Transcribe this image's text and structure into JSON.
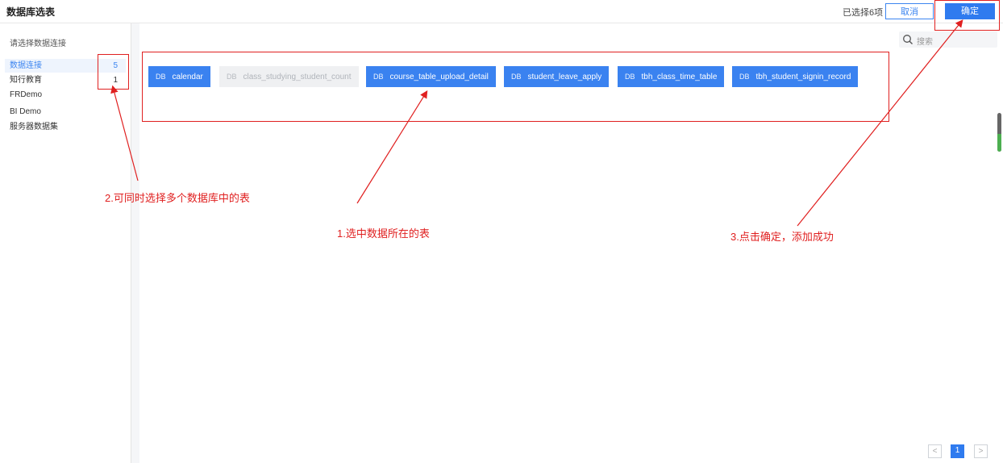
{
  "header": {
    "title": "数据库选表",
    "selected_text": "已选择6项",
    "cancel_label": "取消",
    "ok_label": "确定"
  },
  "sidebar": {
    "header": "请选择数据连接",
    "items": [
      {
        "label": "数据连接",
        "count": "5",
        "active": true
      },
      {
        "label": "知行教育",
        "count": "1",
        "active": false
      },
      {
        "label": "FRDemo",
        "count": "",
        "active": false
      },
      {
        "label": "BI Demo",
        "count": "",
        "active": false
      },
      {
        "label": "服务器数据集",
        "count": "",
        "active": false
      }
    ]
  },
  "search": {
    "placeholder": "搜索"
  },
  "tables": [
    {
      "tag": "DB",
      "name": "calendar",
      "selected": true
    },
    {
      "tag": "DB",
      "name": "class_studying_student_count",
      "selected": false
    },
    {
      "tag": "DB",
      "name": "course_table_upload_detail",
      "selected": true
    },
    {
      "tag": "DB",
      "name": "student_leave_apply",
      "selected": true
    },
    {
      "tag": "DB",
      "name": "tbh_class_time_table",
      "selected": true
    },
    {
      "tag": "DB",
      "name": "tbh_student_signin_record",
      "selected": true
    }
  ],
  "annotations": {
    "a1": "1.选中数据所在的表",
    "a2": "2.可同时选择多个数据库中的表",
    "a3": "3.点击确定，添加成功"
  },
  "pagination": {
    "prev": "<",
    "current": "1",
    "next": ">"
  },
  "colors": {
    "accent": "#2f7bef",
    "annotation": "#e02020",
    "chip_disabled": "#eff0f2"
  }
}
